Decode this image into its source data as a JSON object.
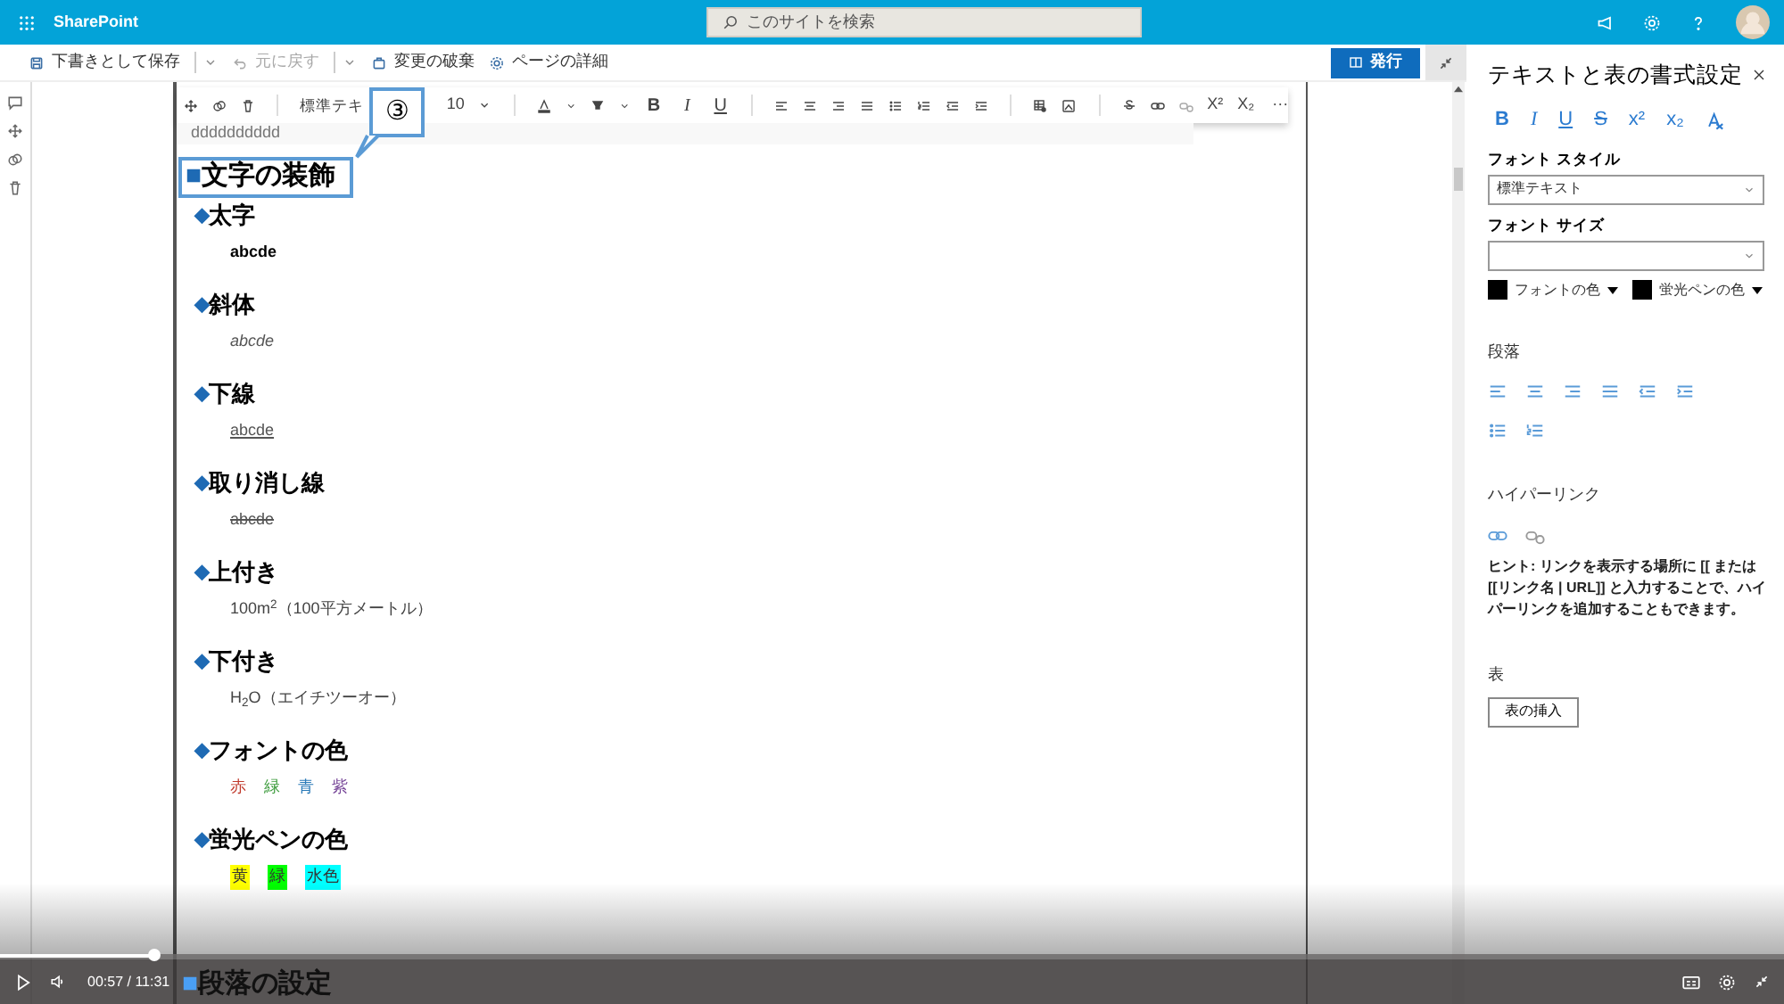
{
  "top_bar": {
    "app_name": "SharePoint",
    "search": {
      "placeholder": "このサイトを検索"
    }
  },
  "command_bar": {
    "items": [
      {
        "label": "下書きとして保存",
        "disabled": false,
        "has_menu": true
      },
      {
        "label": "元に戻す",
        "disabled": true,
        "has_menu": true
      },
      {
        "label": "変更の破棄",
        "disabled": false,
        "has_menu": false
      },
      {
        "label": "ページの詳細",
        "disabled": false,
        "has_menu": false
      }
    ],
    "publish": "発行"
  },
  "text_toolbar": {
    "style": "標準テキ",
    "size": "10",
    "marks": [
      "B",
      "I",
      "U"
    ],
    "scripts": [
      "X²",
      "X₂"
    ],
    "more": "···"
  },
  "document": {
    "first_line": "dddddddddd",
    "heading": {
      "marker": "■",
      "title": "文字の装飾"
    },
    "callout": "③",
    "sections": [
      {
        "marker": "◆",
        "title": "太字",
        "kind": "bold",
        "sample": "abcde"
      },
      {
        "marker": "◆",
        "title": "斜体",
        "kind": "italic",
        "sample": "abcde"
      },
      {
        "marker": "◆",
        "title": "下線",
        "kind": "underline",
        "sample": "abcde"
      },
      {
        "marker": "◆",
        "title": "取り消し線",
        "kind": "strike",
        "sample": "abcde"
      },
      {
        "marker": "◆",
        "title": "上付き",
        "kind": "plain",
        "sample": "100m$^{2}$（100平方メートル）"
      },
      {
        "marker": "◆",
        "title": "下付き",
        "kind": "plain",
        "sample": "H$_{2}$O（エイチツーオー）"
      },
      {
        "marker": "◆",
        "title": "フォントの色",
        "kind": "colors",
        "items": [
          {
            "text": "赤",
            "color": "#c0392b"
          },
          {
            "text": "緑",
            "color": "#3a9a3a"
          },
          {
            "text": "青",
            "color": "#2a7ab8"
          },
          {
            "text": "紫",
            "color": "#7a4a9a"
          }
        ]
      },
      {
        "marker": "◆",
        "title": "蛍光ペンの色",
        "kind": "highlights",
        "items": [
          {
            "text": "黄",
            "color": "#ffff00"
          },
          {
            "text": "緑",
            "color": "#00ff00"
          },
          {
            "text": "水色",
            "color": "#00ffff"
          }
        ]
      }
    ],
    "next_heading": {
      "marker": "■",
      "title": "段落の設定"
    }
  },
  "panel": {
    "title": "テキストと表の書式設定",
    "format_buttons": [
      {
        "kind": "bold",
        "label": "B"
      },
      {
        "kind": "italic",
        "label": "I"
      },
      {
        "kind": "underline",
        "label": "U"
      },
      {
        "kind": "strike",
        "label": "S"
      },
      {
        "kind": "superscript",
        "label": "x²"
      },
      {
        "kind": "subscript",
        "label": "x₂"
      }
    ],
    "font_style_label": "フォント スタイル",
    "font_style_value": "標準テキスト",
    "font_size_label": "フォント サイズ",
    "colors": [
      {
        "label": "フォントの色",
        "color": "#000000"
      },
      {
        "label": "蛍光ペンの色",
        "color": "#000000"
      }
    ],
    "paragraph_label": "段落",
    "hyperlink_label": "ハイパーリンク",
    "hint": "ヒント: リンクを表示する場所に [[ または [[リンク名 | URL]] と入力することで、ハイパーリンクを追加することもできます。",
    "table_label": "表",
    "table_button": "表の挿入"
  },
  "video": {
    "level": 0.086,
    "time": "00:57 / 11:31"
  }
}
